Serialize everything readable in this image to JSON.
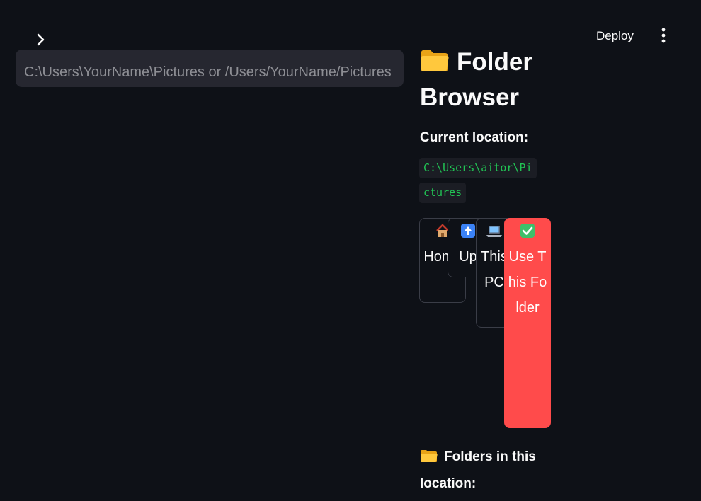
{
  "header": {
    "deploy_label": "Deploy"
  },
  "icons": {
    "sidebar_toggle": "chevron-right-icon",
    "menu": "vertical-dots-icon",
    "folder": "folder-icon",
    "home": "house-icon",
    "up": "up-arrow-icon",
    "pc": "laptop-icon",
    "check": "check-mark-icon"
  },
  "colors": {
    "background": "#0e1117",
    "input_bg": "#262730",
    "primary": "#ff4b4b",
    "code_green": "#21c354",
    "folder_yellow": "#ffc83d"
  },
  "search": {
    "placeholder": "C:\\Users\\YourName\\Pictures or /Users/YourName/Pictures",
    "value": ""
  },
  "browser": {
    "title": "Folder Browser",
    "current_location_label": "Current location:",
    "current_path": "C:\\Users\\aitor\\Pictures",
    "buttons": {
      "home": "Home",
      "up": "Up",
      "pc": "This PC",
      "use": "Use This Folder"
    },
    "folders_heading": "Folders in this location:"
  }
}
